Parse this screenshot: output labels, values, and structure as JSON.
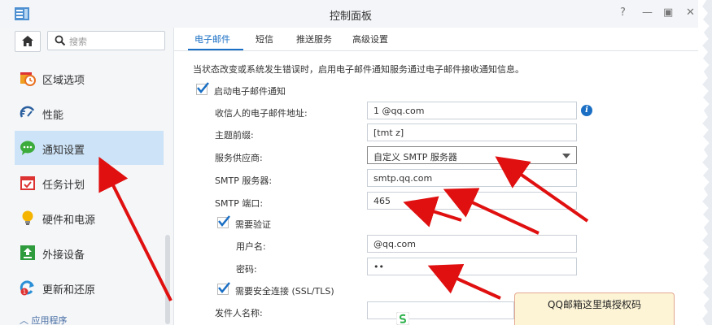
{
  "window": {
    "title": "控制面板"
  },
  "window_controls": {
    "help": "?",
    "minimize": "—",
    "maximize": "▣",
    "close": "✕"
  },
  "sidebar": {
    "search_placeholder": "搜索",
    "items": [
      {
        "label": "区域选项",
        "icon": "calendar-clock-icon"
      },
      {
        "label": "性能",
        "icon": "speedometer-icon"
      },
      {
        "label": "通知设置",
        "icon": "chat-bubble-icon",
        "active": true
      },
      {
        "label": "任务计划",
        "icon": "calendar-check-icon"
      },
      {
        "label": "硬件和电源",
        "icon": "lightbulb-icon"
      },
      {
        "label": "外接设备",
        "icon": "upload-icon"
      },
      {
        "label": "更新和还原",
        "icon": "refresh-icon",
        "badge": "1"
      }
    ],
    "section_toggle": "应用程序"
  },
  "tabs": [
    {
      "label": "电子邮件",
      "active": true
    },
    {
      "label": "短信"
    },
    {
      "label": "推送服务"
    },
    {
      "label": "高级设置"
    }
  ],
  "form": {
    "description": "当状态改变或系统发生错误时，启用电子邮件通知服务通过电子邮件接收通知信息。",
    "enable_email": {
      "label": "启动电子邮件通知",
      "checked": true
    },
    "recipient": {
      "label": "收信人的电子邮件地址:",
      "value": "1          @qq.com"
    },
    "subject_prefix": {
      "label": "主题前缀:",
      "value": "[tmt              z]"
    },
    "provider": {
      "label": "服务供应商:",
      "value": "自定义 SMTP 服务器"
    },
    "smtp_server": {
      "label": "SMTP 服务器:",
      "value": "smtp.qq.com"
    },
    "smtp_port": {
      "label": "SMTP 端口:",
      "value": "465"
    },
    "require_auth": {
      "label": "需要验证",
      "checked": true
    },
    "username": {
      "label": "用户名:",
      "value": "          @qq.com"
    },
    "password": {
      "label": "密码:",
      "value": "••"
    },
    "secure_conn": {
      "label": "需要安全连接 (SSL/TLS)",
      "checked": true
    },
    "sender_name": {
      "label": "发件人名称:",
      "value": ""
    }
  },
  "annotation": {
    "note": "QQ邮箱这里填授权码"
  },
  "colors": {
    "accent": "#1a6fc4",
    "arrow": "#e01010",
    "active_bg": "#cde3f7"
  }
}
